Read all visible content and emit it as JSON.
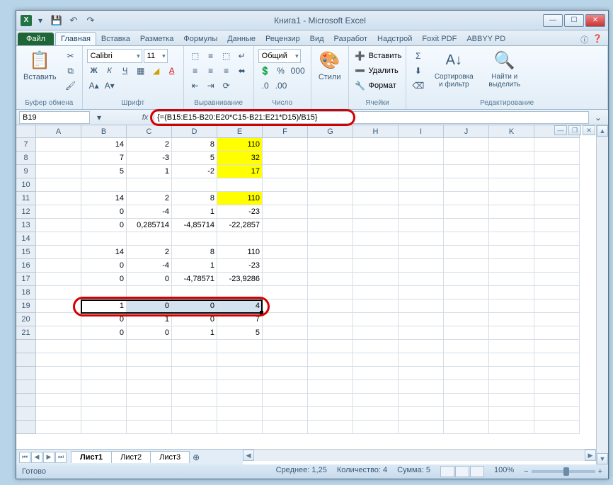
{
  "title": "Книга1 - Microsoft Excel",
  "qat": {
    "excel": "X"
  },
  "tabs": {
    "file": "Файл",
    "items": [
      "Главная",
      "Вставка",
      "Разметка",
      "Формулы",
      "Данные",
      "Рецензир",
      "Вид",
      "Разработ",
      "Надстрой",
      "Foxit PDF",
      "ABBYY PD"
    ],
    "active": 0
  },
  "ribbon": {
    "clipboard": {
      "paste": "Вставить",
      "label": "Буфер обмена"
    },
    "font": {
      "name": "Calibri",
      "size": "11",
      "label": "Шрифт"
    },
    "align": {
      "label": "Выравнивание"
    },
    "number": {
      "format": "Общий",
      "label": "Число"
    },
    "styles": {
      "btn": "Стили"
    },
    "cells": {
      "insert": "Вставить",
      "delete": "Удалить",
      "format": "Формат",
      "label": "Ячейки"
    },
    "editing": {
      "sort": "Сортировка и фильтр",
      "find": "Найти и выделить",
      "label": "Редактирование"
    }
  },
  "namebox": "B19",
  "formula": "{=(B15:E15-B20:E20*C15-B21:E21*D15)/B15}",
  "columns": [
    "A",
    "B",
    "C",
    "D",
    "E",
    "F",
    "G",
    "H",
    "I",
    "J",
    "K",
    "L"
  ],
  "rows": [
    "7",
    "8",
    "9",
    "10",
    "11",
    "12",
    "13",
    "14",
    "15",
    "16",
    "17",
    "18",
    "19",
    "20",
    "21",
    "",
    "",
    "",
    "",
    "",
    "",
    ""
  ],
  "cells": {
    "r7": {
      "B": "14",
      "C": "2",
      "D": "8",
      "E": "110"
    },
    "r8": {
      "B": "7",
      "C": "-3",
      "D": "5",
      "E": "32"
    },
    "r9": {
      "B": "5",
      "C": "1",
      "D": "-2",
      "E": "17"
    },
    "r11": {
      "B": "14",
      "C": "2",
      "D": "8",
      "E": "110"
    },
    "r12": {
      "B": "0",
      "C": "-4",
      "D": "1",
      "E": "-23"
    },
    "r13": {
      "B": "0",
      "C": "0,285714",
      "D": "-4,85714",
      "E": "-22,2857"
    },
    "r15": {
      "B": "14",
      "C": "2",
      "D": "8",
      "E": "110"
    },
    "r16": {
      "B": "0",
      "C": "-4",
      "D": "1",
      "E": "-23"
    },
    "r17": {
      "B": "0",
      "C": "0",
      "D": "-4,78571",
      "E": "-23,9286"
    },
    "r19": {
      "B": "1",
      "C": "0",
      "D": "0",
      "E": "4"
    },
    "r20": {
      "B": "0",
      "C": "1",
      "D": "0",
      "E": "7"
    },
    "r21": {
      "B": "0",
      "C": "0",
      "D": "1",
      "E": "5"
    }
  },
  "yellow_rows": [
    "7",
    "8",
    "9",
    "11"
  ],
  "sheets": {
    "items": [
      "Лист1",
      "Лист2",
      "Лист3"
    ],
    "active": 0
  },
  "status": {
    "ready": "Готово",
    "avg_label": "Среднее:",
    "avg": "1,25",
    "count_label": "Количество:",
    "count": "4",
    "sum_label": "Сумма:",
    "sum": "5",
    "zoom": "100%"
  }
}
